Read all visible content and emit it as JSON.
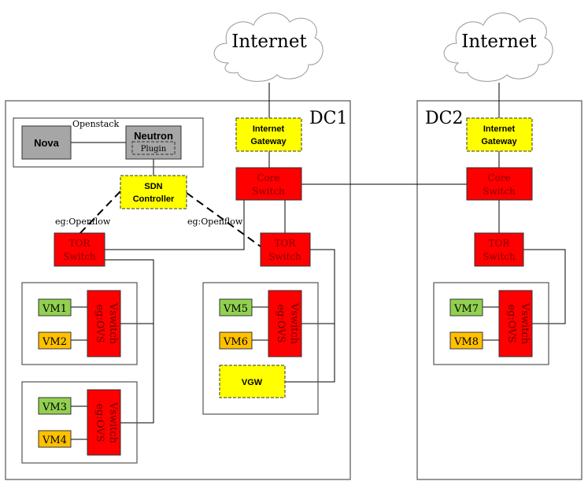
{
  "colors": {
    "switch": "#ff0000",
    "gateway": "#ffff00",
    "vm_green": "#92d050",
    "vm_orange": "#ffc000",
    "openstack_component": "#a6a6a6"
  },
  "clouds": [
    {
      "label": "Internet"
    },
    {
      "label": "Internet"
    }
  ],
  "dc1": {
    "label": "DC1",
    "internet_gateway": [
      "Internet",
      "Gateway"
    ],
    "core_switch": [
      "Core",
      "Switch"
    ],
    "openstack": {
      "label": "Openstack",
      "nova": "Nova",
      "neutron": "Neutron",
      "plugin": "Plugin"
    },
    "sdn_controller": [
      "SDN",
      "Controller"
    ],
    "openflow_labels": [
      "eg:Openflow",
      "eg:Openflow"
    ],
    "tor_switches": [
      [
        "TOR",
        "Switch"
      ],
      [
        "TOR",
        "Switch"
      ]
    ],
    "vswitch": [
      "Vswitch",
      "eg:OVS"
    ],
    "vms": [
      "VM1",
      "VM2",
      "VM3",
      "VM4",
      "VM5",
      "VM6"
    ],
    "vgw": "VGW"
  },
  "dc2": {
    "label": "DC2",
    "internet_gateway": [
      "Internet",
      "Gateway"
    ],
    "core_switch": [
      "Core",
      "Switch"
    ],
    "tor_switch": [
      "TOR",
      "Switch"
    ],
    "vswitch": [
      "Vswitch",
      "eg:OVS"
    ],
    "vms": [
      "VM7",
      "VM8"
    ]
  }
}
